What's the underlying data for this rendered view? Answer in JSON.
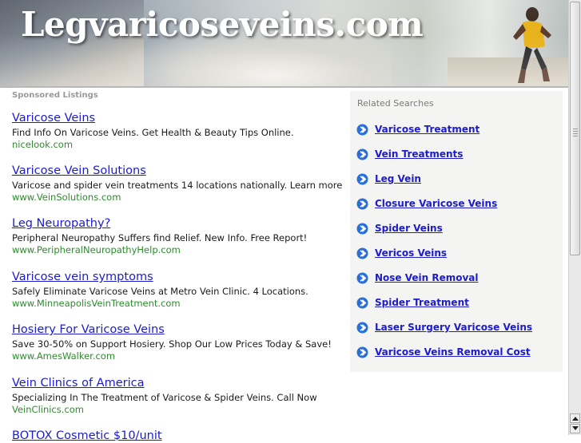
{
  "header": {
    "site_title": "Legvaricoseveins.com"
  },
  "sponsored": {
    "heading": "Sponsored Listings",
    "listings": [
      {
        "title": "Varicose Veins",
        "description": "Find Info On Varicose Veins. Get Health & Beauty Tips Online.",
        "url": "nicelook.com"
      },
      {
        "title": "Varicose Vein Solutions",
        "description": "Varicose and spider vein treatments 14 locations nationally. Learn more",
        "url": "www.VeinSolutions.com"
      },
      {
        "title": "Leg Neuropathy?",
        "description": "Peripheral Neuropathy Suffers find Relief. New Info. Free Report!",
        "url": "www.PeripheralNeuropathyHelp.com"
      },
      {
        "title": "Varicose vein symptoms",
        "description": "Safely Eliminate Varicose Veins at Metro Vein Clinic. 4 Locations.",
        "url": "www.MinneapolisVeinTreatment.com"
      },
      {
        "title": "Hosiery For Varicose Veins",
        "description": "Save 30-50% on Support Hosiery. Shop Our Low Prices Today & Save!",
        "url": "www.AmesWalker.com"
      },
      {
        "title": "Vein Clinics of America",
        "description": "Specializing In The Treatment of Varicose & Spider Veins. Call Now",
        "url": "VeinClinics.com"
      },
      {
        "title": "BOTOX Cosmetic $10/unit",
        "description": "",
        "url": ""
      }
    ]
  },
  "related": {
    "heading": "Related Searches",
    "items": [
      "Varicose Treatment",
      "Vein Treatments",
      "Leg Vein",
      "Closure Varicose Veins",
      "Spider Veins",
      "Vericos Veins",
      "Nose Vein Removal",
      "Spider Treatment",
      "Laser Surgery Varicose Veins",
      "Varicose Veins Removal Cost"
    ]
  },
  "colors": {
    "link": "#1c1ccc",
    "url_green": "#2e8b2e",
    "arrow_blue": "#2a6fd6",
    "related_bg": "#f4f4f2"
  }
}
